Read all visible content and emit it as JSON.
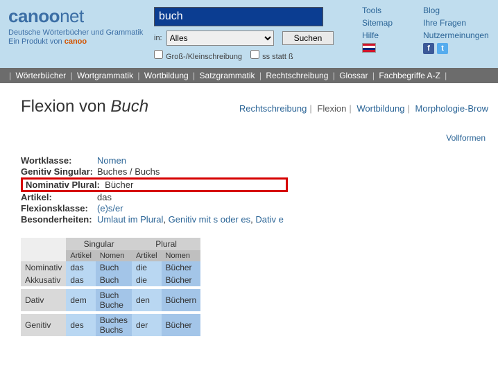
{
  "brand": {
    "logo_pre": "canoo",
    "logo_suf": "net",
    "tagline1": "Deutsche Wörterbücher und Grammatik",
    "tagline2_pre": "Ein Produkt von ",
    "tagline2_brand": "canoo"
  },
  "search": {
    "value": "buch",
    "in_label": "in:",
    "select_value": "Alles",
    "button": "Suchen",
    "opt_case_label": "Groß-/Kleinschreibung",
    "opt_ss_label": "ss statt ß"
  },
  "top_links": {
    "col1": [
      "Tools",
      "Sitemap",
      "Hilfe"
    ],
    "col2": [
      "Blog",
      "Ihre Fragen",
      "Nutzermeinungen"
    ]
  },
  "nav": [
    "Wörterbücher",
    "Wortgrammatik",
    "Wortbildung",
    "Satzgrammatik",
    "Rechtschreibung",
    "Glossar",
    "Fachbegriffe A-Z"
  ],
  "main": {
    "title_pre": "Flexion von ",
    "title_word": "Buch",
    "tabs": [
      "Rechtschreibung",
      "Flexion",
      "Wortbildung",
      "Morphologie-Brow"
    ],
    "active_tab_index": 1,
    "vollformen": "Vollformen"
  },
  "summary": {
    "rows": {
      "wortklasse": {
        "label": "Wortklasse:",
        "value": "Nomen",
        "link": true
      },
      "gen_sg": {
        "label": "Genitiv Singular:",
        "value": "Buches / Buchs"
      },
      "nom_pl": {
        "label": "Nominativ Plural:",
        "value": "Bücher",
        "highlight": true
      },
      "artikel": {
        "label": "Artikel:",
        "value": "das"
      },
      "flexion": {
        "label": "Flexionsklasse:",
        "value": "(e)s/er",
        "link": true
      },
      "besonder": {
        "label": "Besonderheiten:",
        "values": [
          "Umlaut im Plural",
          "Genitiv mit s oder es",
          "Dativ e"
        ],
        "link": true
      }
    }
  },
  "decl": {
    "groups": [
      "Singular",
      "Plural"
    ],
    "subheads": [
      "Artikel",
      "Nomen"
    ],
    "cases": [
      "Nominativ",
      "Akkusativ",
      "Dativ",
      "Genitiv"
    ],
    "cells": {
      "Nominativ": {
        "sg": {
          "art": "das",
          "nom": "Buch"
        },
        "pl": {
          "art": "die",
          "nom": "Bücher"
        }
      },
      "Akkusativ": {
        "sg": {
          "art": "das",
          "nom": "Buch"
        },
        "pl": {
          "art": "die",
          "nom": "Bücher"
        }
      },
      "Dativ": {
        "sg": {
          "art": "dem",
          "nom": "Buch\nBuche"
        },
        "pl": {
          "art": "den",
          "nom": "Büchern"
        }
      },
      "Genitiv": {
        "sg": {
          "art": "des",
          "nom": "Buches\nBuchs"
        },
        "pl": {
          "art": "der",
          "nom": "Bücher"
        }
      }
    }
  }
}
